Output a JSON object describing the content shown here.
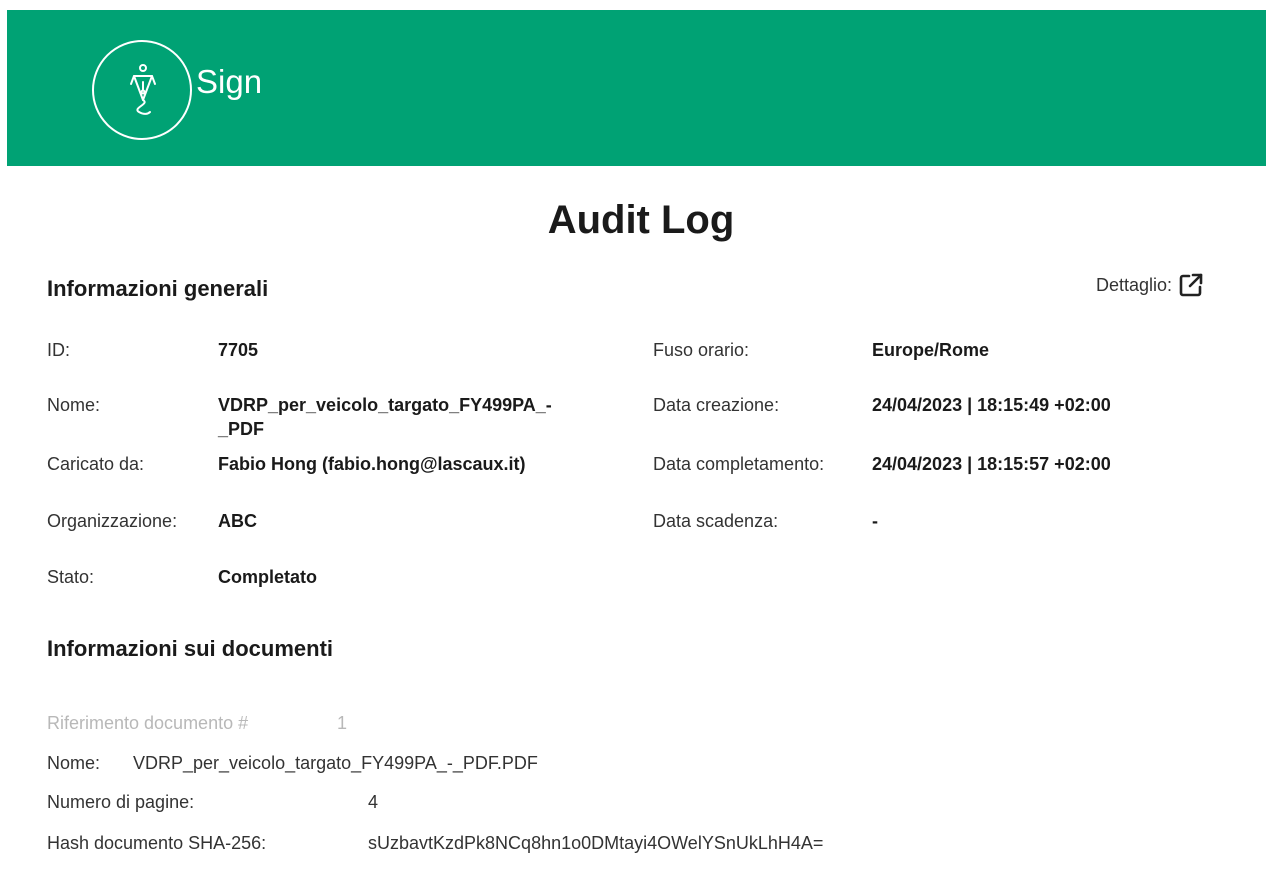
{
  "brand": {
    "name": "Sign",
    "accent_color": "#00a274",
    "logo_icon": "pen-nib-icon"
  },
  "page_title": "Audit Log",
  "general": {
    "title": "Informazioni generali",
    "detail_label": "Dettaglio:",
    "detail_icon": "external-link-icon",
    "left": [
      {
        "label": "ID:",
        "value": "7705"
      },
      {
        "label": "Nome:",
        "value": "VDRP_per_veicolo_targato_FY499PA_-\n_PDF"
      },
      {
        "label": "Caricato da:",
        "value": "Fabio Hong (fabio.hong@lascaux.it)"
      },
      {
        "label": "Organizzazione:",
        "value": "ABC"
      },
      {
        "label": "Stato:",
        "value": "Completato"
      }
    ],
    "right": [
      {
        "label": "Fuso orario:",
        "value": "Europe/Rome"
      },
      {
        "label": "Data creazione:",
        "value": "24/04/2023 | 18:15:49 +02:00"
      },
      {
        "label": "Data completamento:",
        "value": "24/04/2023 | 18:15:57 +02:00"
      },
      {
        "label": "Data scadenza:",
        "value": "-"
      }
    ]
  },
  "documents": {
    "title": "Informazioni sui documenti",
    "reference_label": "Riferimento documento #",
    "reference_value": "1",
    "name_label": "Nome:",
    "name_value": "VDRP_per_veicolo_targato_FY499PA_-_PDF.PDF",
    "pages_label": "Numero di pagine:",
    "pages_value": "4",
    "hash_label": "Hash documento SHA-256:",
    "hash_value": "sUzbavtKzdPk8NCq8hn1o0DMtayi4OWelYSnUkLhH4A="
  }
}
